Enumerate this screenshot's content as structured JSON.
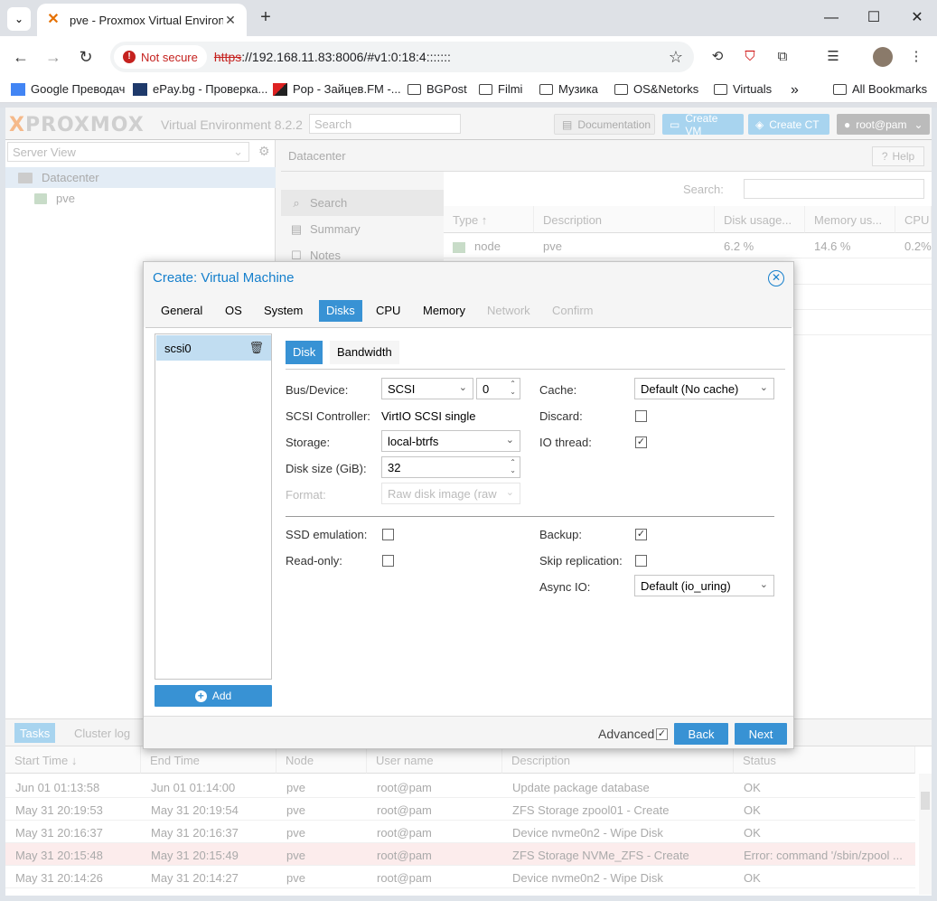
{
  "browser": {
    "tab_title": "pve - Proxmox Virtual Environme",
    "tab_close": "✕",
    "new_tab": "+",
    "not_secure": "Not secure",
    "url_scheme": "https",
    "url_rest": "://192.168.11.83:8006/#v1:0:18:4:::::::",
    "bookmarks": [
      {
        "label": "Google Преводач"
      },
      {
        "label": "ePay.bg - Проверка..."
      },
      {
        "label": "Pop - Зайцев.FM -..."
      },
      {
        "label": "BGPost"
      },
      {
        "label": "Filmi"
      },
      {
        "label": "Музика"
      },
      {
        "label": "OS&Netorks"
      },
      {
        "label": "Virtuals"
      },
      {
        "label": "All Bookmarks"
      }
    ],
    "more_bookmarks": "»"
  },
  "pve": {
    "logo": "PROXMOX",
    "version": "Virtual Environment 8.2.2",
    "search_placeholder": "Search",
    "documentation": "Documentation",
    "create_vm": "Create VM",
    "create_ct": "Create CT",
    "user": "root@pam",
    "server_view": "Server View",
    "tree": {
      "datacenter": "Datacenter",
      "node": "pve"
    },
    "content_title": "Datacenter",
    "help": "Help",
    "subnav": [
      "Search",
      "Summary",
      "Notes"
    ],
    "grid_search_label": "Search:",
    "grid_headers": [
      "Type ↑",
      "Description",
      "Disk usage...",
      "Memory us...",
      "CPU"
    ],
    "grid_row": {
      "type": "node",
      "description": "pve",
      "disk": "6.2 %",
      "memory": "14.6 %",
      "cpu": "0.2%"
    }
  },
  "tasks": {
    "tab_tasks": "Tasks",
    "tab_cluster": "Cluster log",
    "headers": [
      "Start Time ↓",
      "End Time",
      "Node",
      "User name",
      "Description",
      "Status"
    ],
    "rows": [
      {
        "start": "Jun 01 01:13:58",
        "end": "Jun 01 01:14:00",
        "node": "pve",
        "user": "root@pam",
        "desc": "Update package database",
        "status": "OK"
      },
      {
        "start": "May 31 20:19:53",
        "end": "May 31 20:19:54",
        "node": "pve",
        "user": "root@pam",
        "desc": "ZFS Storage zpool01 - Create",
        "status": "OK"
      },
      {
        "start": "May 31 20:16:37",
        "end": "May 31 20:16:37",
        "node": "pve",
        "user": "root@pam",
        "desc": "Device nvme0n2 - Wipe Disk",
        "status": "OK"
      },
      {
        "start": "May 31 20:15:48",
        "end": "May 31 20:15:49",
        "node": "pve",
        "user": "root@pam",
        "desc": "ZFS Storage NVMe_ZFS - Create",
        "status": "Error: command '/sbin/zpool ..."
      },
      {
        "start": "May 31 20:14:26",
        "end": "May 31 20:14:27",
        "node": "pve",
        "user": "root@pam",
        "desc": "Device nvme0n2 - Wipe Disk",
        "status": "OK"
      }
    ]
  },
  "dialog": {
    "title": "Create: Virtual Machine",
    "tabs": [
      "General",
      "OS",
      "System",
      "Disks",
      "CPU",
      "Memory",
      "Network",
      "Confirm"
    ],
    "disk_item": "scsi0",
    "add": "Add",
    "subtabs": [
      "Disk",
      "Bandwidth"
    ],
    "fields": {
      "bus_device_label": "Bus/Device:",
      "bus_value": "SCSI",
      "device_index": "0",
      "scsi_controller_label": "SCSI Controller:",
      "scsi_controller_value": "VirtIO SCSI single",
      "storage_label": "Storage:",
      "storage_value": "local-btrfs",
      "disk_size_label": "Disk size (GiB):",
      "disk_size_value": "32",
      "format_label": "Format:",
      "format_value": "Raw disk image (raw",
      "cache_label": "Cache:",
      "cache_value": "Default (No cache)",
      "discard_label": "Discard:",
      "io_thread_label": "IO thread:",
      "ssd_label": "SSD emulation:",
      "readonly_label": "Read-only:",
      "backup_label": "Backup:",
      "skip_repl_label": "Skip replication:",
      "async_io_label": "Async IO:",
      "async_io_value": "Default (io_uring)"
    },
    "checks": {
      "discard": false,
      "io_thread": true,
      "ssd": false,
      "readonly": false,
      "backup": true,
      "skip_replication": false,
      "advanced": true
    },
    "advanced": "Advanced",
    "back": "Back",
    "next": "Next"
  },
  "colors": {
    "accent": "#3892d4",
    "title": "#157fcc",
    "selected": "#c1ddf1"
  }
}
